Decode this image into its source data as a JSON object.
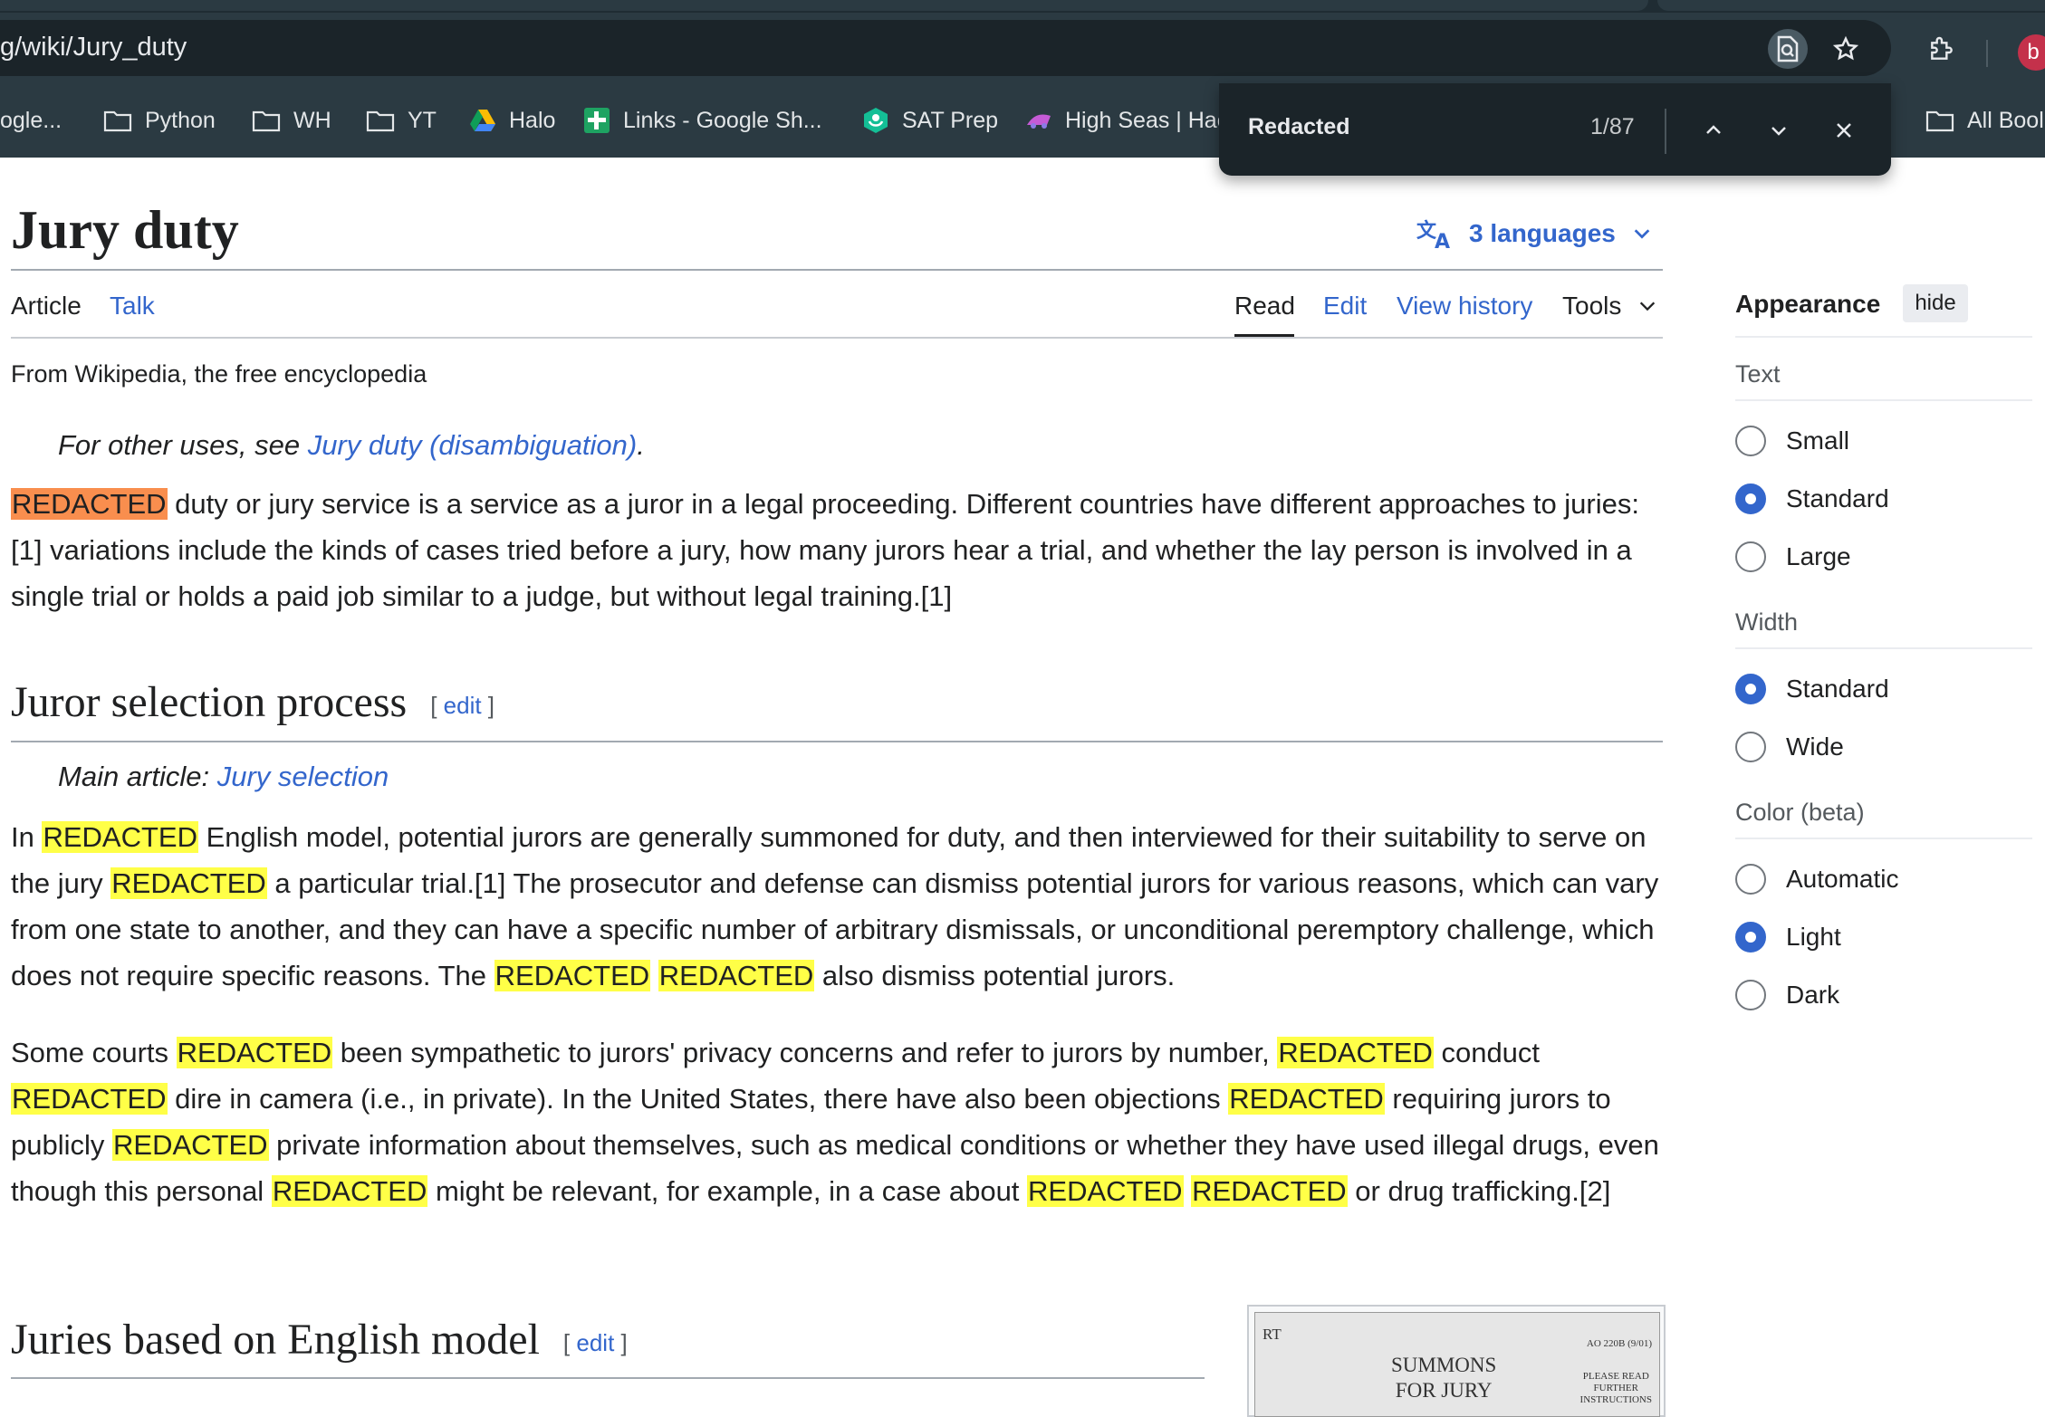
{
  "browser": {
    "url": "g/wiki/Jury_duty",
    "profile_initial": "b",
    "bookmarks": [
      {
        "label": "ogle...",
        "icon": "none"
      },
      {
        "label": "Python",
        "icon": "folder-icon"
      },
      {
        "label": "WH",
        "icon": "folder-icon"
      },
      {
        "label": "YT",
        "icon": "folder-icon"
      },
      {
        "label": "Halo",
        "icon": "google-drive-icon"
      },
      {
        "label": "Links - Google Sh...",
        "icon": "google-sheets-icon"
      },
      {
        "label": "SAT Prep",
        "icon": "khan-academy-icon"
      },
      {
        "label": "High Seas | Hac",
        "icon": "hack-club-icon"
      },
      {
        "label": "All Bool",
        "icon": "folder-icon"
      }
    ],
    "find_bar": {
      "query": "Redacted",
      "count": "1/87"
    }
  },
  "article": {
    "title": "Jury duty",
    "languages_label": "3 languages",
    "tabs": {
      "article": "Article",
      "talk": "Talk",
      "read": "Read",
      "edit": "Edit",
      "view_history": "View history",
      "tools": "Tools"
    },
    "tagline": "From Wikipedia, the free encyclopedia",
    "hatnote": {
      "prefix": "For other uses, see ",
      "link": "Jury duty (disambiguation)",
      "suffix": "."
    },
    "intro": {
      "highlight_current": "REDACTED",
      "text": " duty or jury service is a service as a juror in a legal proceeding. Different countries have different approaches to juries:[1] variations include the kinds of cases tried before a jury, how many jurors hear a trial, and whether the lay person is involved in a single trial or holds a paid job similar to a judge, but without legal training.[1]"
    },
    "sections": [
      {
        "heading": "Juror selection process",
        "edit_open": "[ ",
        "edit_label": "edit",
        "edit_close": " ]",
        "main_article_prefix": "Main article: ",
        "main_article_link": "Jury selection",
        "paragraphs": [
          [
            "In ",
            "REDACTED",
            " English model, potential jurors are generally summoned for duty, and then interviewed for their suitability to serve on the jury ",
            "REDACTED",
            " a particular trial.[1] The prosecutor and defense can dismiss potential jurors for various reasons, which can vary from one state to another, and they can have a specific number of arbitrary dismissals, or unconditional peremptory challenge, which does not require specific reasons. The ",
            "REDACTED",
            " ",
            "REDACTED",
            " also dismiss potential jurors."
          ],
          [
            "Some courts ",
            "REDACTED",
            " been sympathetic to jurors' privacy concerns and refer to jurors by number, ",
            "REDACTED",
            " conduct ",
            "REDACTED",
            " dire in camera (i.e., in private). In the United States, there have also been objections ",
            "REDACTED",
            " requiring jurors to publicly ",
            "REDACTED",
            " private information about themselves, such as medical conditions or whether they have used illegal drugs, even though this personal ",
            "REDACTED",
            " might be relevant, for example, in a case about ",
            "REDACTED",
            " ",
            "REDACTED",
            " or drug trafficking.[2]"
          ]
        ]
      },
      {
        "heading": "Juries based on English model",
        "edit_open": "[ ",
        "edit_label": "edit",
        "edit_close": " ]"
      }
    ],
    "thumbnail": {
      "corner": "RT",
      "title_line1": "SUMMONS",
      "title_line2": "FOR JURY",
      "form_no": "AO 220B (9/01)",
      "note_line1": "PLEASE READ",
      "note_line2": "FURTHER",
      "note_line3": "INSTRUCTIONS"
    }
  },
  "appearance": {
    "title": "Appearance",
    "hide_label": "hide",
    "groups": [
      {
        "label": "Text",
        "options": [
          "Small",
          "Standard",
          "Large"
        ],
        "selected": "Standard"
      },
      {
        "label": "Width",
        "options": [
          "Standard",
          "Wide"
        ],
        "selected": "Standard"
      },
      {
        "label": "Color (beta)",
        "options": [
          "Automatic",
          "Light",
          "Dark"
        ],
        "selected": "Light"
      }
    ]
  },
  "colors": {
    "link": "#3366cc",
    "highlight": "#ffff47",
    "current_highlight": "#f98e4e",
    "chrome_bg": "#2b3a42"
  }
}
